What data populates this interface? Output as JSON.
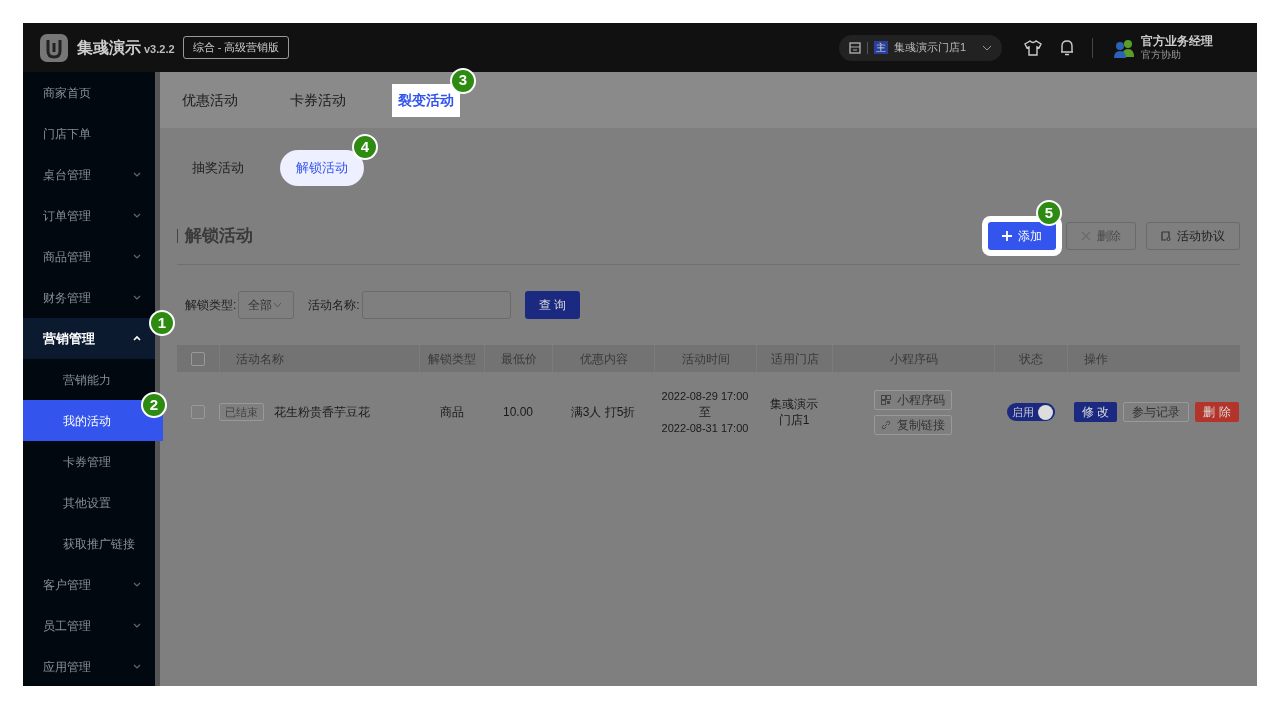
{
  "header": {
    "app_name": "集彧演示",
    "version": "v3.2.2",
    "edition": "综合 - 高级营销版",
    "store": {
      "badge": "主",
      "name": "集彧演示门店1"
    },
    "user": {
      "name": "官方业务经理",
      "role": "官方协助"
    }
  },
  "sidebar": {
    "items": [
      {
        "label": "商家首页",
        "kind": "link",
        "selected": false
      },
      {
        "label": "门店下单",
        "kind": "link",
        "selected": false
      },
      {
        "label": "桌台管理",
        "kind": "group",
        "expanded": false
      },
      {
        "label": "订单管理",
        "kind": "group",
        "expanded": false
      },
      {
        "label": "商品管理",
        "kind": "group",
        "expanded": false
      },
      {
        "label": "财务管理",
        "kind": "group",
        "expanded": false
      },
      {
        "label": "营销管理",
        "kind": "group",
        "expanded": true,
        "callout": "1",
        "children": [
          {
            "label": "营销能力",
            "selected": false
          },
          {
            "label": "我的活动",
            "selected": true,
            "callout": "2"
          },
          {
            "label": "卡券管理",
            "selected": false
          },
          {
            "label": "其他设置",
            "selected": false
          },
          {
            "label": "获取推广链接",
            "selected": false
          }
        ]
      },
      {
        "label": "客户管理",
        "kind": "group",
        "expanded": false
      },
      {
        "label": "员工管理",
        "kind": "group",
        "expanded": false
      },
      {
        "label": "应用管理",
        "kind": "group",
        "expanded": false
      }
    ]
  },
  "tabs": [
    {
      "label": "优惠活动",
      "selected": false
    },
    {
      "label": "卡券活动",
      "selected": false
    },
    {
      "label": "裂变活动",
      "selected": true,
      "callout": "3"
    }
  ],
  "subtabs": [
    {
      "label": "抽奖活动",
      "selected": false
    },
    {
      "label": "解锁活动",
      "selected": true,
      "callout": "4"
    }
  ],
  "section": {
    "title": "解锁活动",
    "buttons": [
      {
        "label": "添加",
        "kind": "add",
        "disabled": false,
        "callout": "5"
      },
      {
        "label": "删除",
        "kind": "delete",
        "disabled": true
      },
      {
        "label": "活动协议",
        "kind": "doc",
        "disabled": false
      }
    ]
  },
  "filters": {
    "type_label": "解锁类型:",
    "type_value": "全部",
    "name_label": "活动名称:",
    "query_button": "查 询"
  },
  "table": {
    "all_checked": false,
    "columns": [
      "活动名称",
      "解锁类型",
      "最低价",
      "优惠内容",
      "活动时间",
      "适用门店",
      "小程序码",
      "状态",
      "操作"
    ],
    "rows": [
      {
        "checked": false,
        "status_tag": "已结束",
        "name": "花生粉贵香芋豆花",
        "type": "商品",
        "min_price": "10.00",
        "discount": "满3人 打5折",
        "time_start": "2022-08-29 17:00",
        "time_sep": "至",
        "time_end": "2022-08-31 17:00",
        "store": "集彧演示门店1",
        "qr_button": "小程序码",
        "link_button": "复制链接",
        "toggle": {
          "label": "启用",
          "on": true
        },
        "actions": [
          {
            "label": "修 改",
            "kind": "primary"
          },
          {
            "label": "参与记录",
            "kind": "outline"
          },
          {
            "label": "删 除",
            "kind": "danger"
          }
        ]
      }
    ]
  }
}
